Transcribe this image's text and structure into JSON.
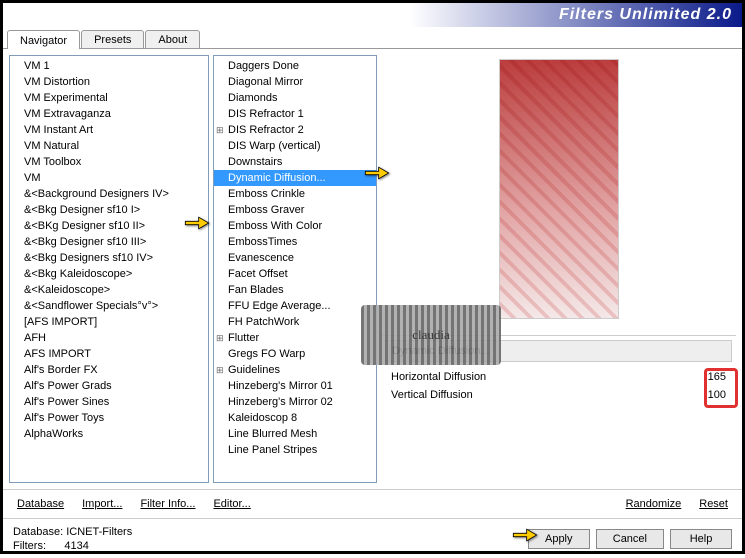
{
  "title": "Filters Unlimited 2.0",
  "tabs": [
    "Navigator",
    "Presets",
    "About"
  ],
  "activeTab": 0,
  "categories": [
    "VM 1",
    "VM Distortion",
    "VM Experimental",
    "VM Extravaganza",
    "VM Instant Art",
    "VM Natural",
    "VM Toolbox",
    "VM",
    "&<Background Designers IV>",
    "&<Bkg Designer sf10 I>",
    "&<BKg Designer sf10 II>",
    "&<Bkg Designer sf10 III>",
    "&<Bkg Designers sf10 IV>",
    "&<Bkg Kaleidoscope>",
    "&<Kaleidoscope>",
    "&<Sandflower Specials°v°>",
    "[AFS IMPORT]",
    "AFH",
    "AFS IMPORT",
    "Alf's Border FX",
    "Alf's Power Grads",
    "Alf's Power Sines",
    "Alf's Power Toys",
    "AlphaWorks"
  ],
  "selectedCategoryIndex": 10,
  "filters": [
    {
      "n": "Daggers Done"
    },
    {
      "n": "Diagonal Mirror"
    },
    {
      "n": "Diamonds"
    },
    {
      "n": "DIS Refractor 1"
    },
    {
      "n": "DIS Refractor 2",
      "e": true
    },
    {
      "n": "DIS Warp (vertical)"
    },
    {
      "n": "Downstairs"
    },
    {
      "n": "Dynamic Diffusion...",
      "sel": true
    },
    {
      "n": "Emboss Crinkle"
    },
    {
      "n": "Emboss Graver"
    },
    {
      "n": "Emboss With Color"
    },
    {
      "n": "EmbossTimes"
    },
    {
      "n": "Evanescence"
    },
    {
      "n": "Facet Offset"
    },
    {
      "n": "Fan Blades"
    },
    {
      "n": "FFU Edge Average..."
    },
    {
      "n": "FH PatchWork"
    },
    {
      "n": "Flutter",
      "e": true
    },
    {
      "n": "Gregs FO Warp"
    },
    {
      "n": "Guidelines",
      "e": true
    },
    {
      "n": "Hinzeberg's Mirror 01"
    },
    {
      "n": "Hinzeberg's Mirror 02"
    },
    {
      "n": "Kaleidoscop 8"
    },
    {
      "n": "Line Blurred Mesh"
    },
    {
      "n": "Line Panel Stripes"
    }
  ],
  "paramTitle": "Dynamic Diffusion...",
  "params": [
    {
      "label": "Horizontal Diffusion",
      "value": "165"
    },
    {
      "label": "Vertical Diffusion",
      "value": "100"
    }
  ],
  "bottomLinks": {
    "database": "Database",
    "import": "Import...",
    "filterInfo": "Filter Info...",
    "editor": "Editor...",
    "randomize": "Randomize",
    "reset": "Reset"
  },
  "footer": {
    "dbLabel": "Database:",
    "dbValue": "ICNET-Filters",
    "filtersLabel": "Filters:",
    "filtersValue": "4134"
  },
  "buttons": {
    "apply": "Apply",
    "cancel": "Cancel",
    "help": "Help"
  },
  "watermark": "claudia"
}
